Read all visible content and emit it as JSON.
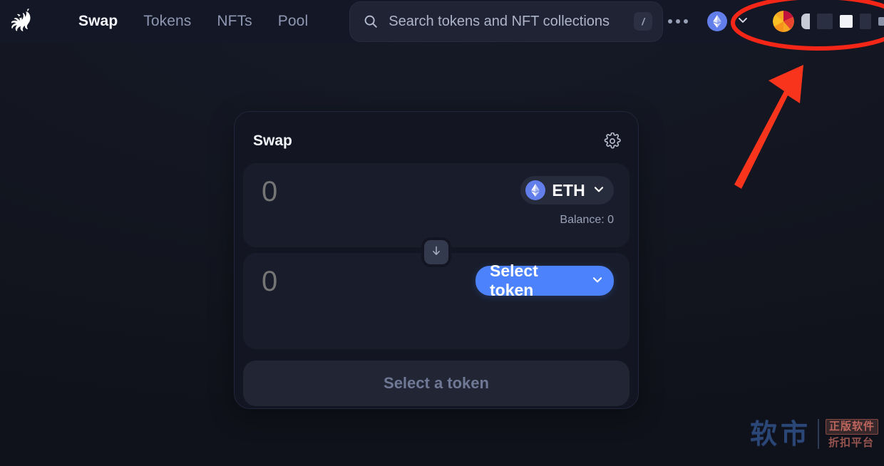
{
  "app": {
    "name": "Uniswap",
    "logo_icon": "unicorn-logo-icon",
    "background_color": "#131620"
  },
  "header": {
    "nav_items": [
      {
        "label": "Swap",
        "active": true
      },
      {
        "label": "Tokens",
        "active": false
      },
      {
        "label": "NFTs",
        "active": false
      },
      {
        "label": "Pool",
        "active": false
      }
    ],
    "search": {
      "placeholder": "Search tokens and NFT collections",
      "value": "",
      "icon": "search-icon",
      "shortcut_key": "/"
    },
    "more_menu": {
      "icon": "more-horizontal-icon",
      "label": ""
    },
    "network_selector": {
      "network": "Ethereum",
      "icon": "ethereum-icon",
      "chevron": "chevron-down-icon"
    },
    "extensions": {
      "wallet_icon": "rainbow-wallet-extension-icon"
    }
  },
  "swap_card": {
    "title": "Swap",
    "settings_icon": "gear-icon",
    "input_panel": {
      "amount_value": "",
      "amount_placeholder": "0",
      "token_symbol": "ETH",
      "token_icon": "ethereum-token-icon",
      "chevron": "chevron-down-icon",
      "balance_label": "Balance: 0"
    },
    "swap_direction_button": {
      "icon": "arrow-down-icon"
    },
    "output_panel": {
      "amount_value": "",
      "amount_placeholder": "0",
      "select_token_label": "Select token",
      "chevron": "chevron-down-icon"
    },
    "cta": {
      "label": "Select a token",
      "disabled": true
    }
  },
  "annotations": {
    "highlight_ellipse": {
      "shape": "ellipse",
      "color": "#f42617",
      "target": "browser-extension-toolbar"
    },
    "pointer_arrow": {
      "shape": "arrow",
      "color": "#f42617",
      "points_to": "browser-extension-toolbar"
    }
  },
  "watermark": {
    "main_text": "软市",
    "badge_text": "正版软件",
    "sub_text": "折扣平台",
    "main_color": "#2d4a7e",
    "badge_color": "#c86b62"
  }
}
